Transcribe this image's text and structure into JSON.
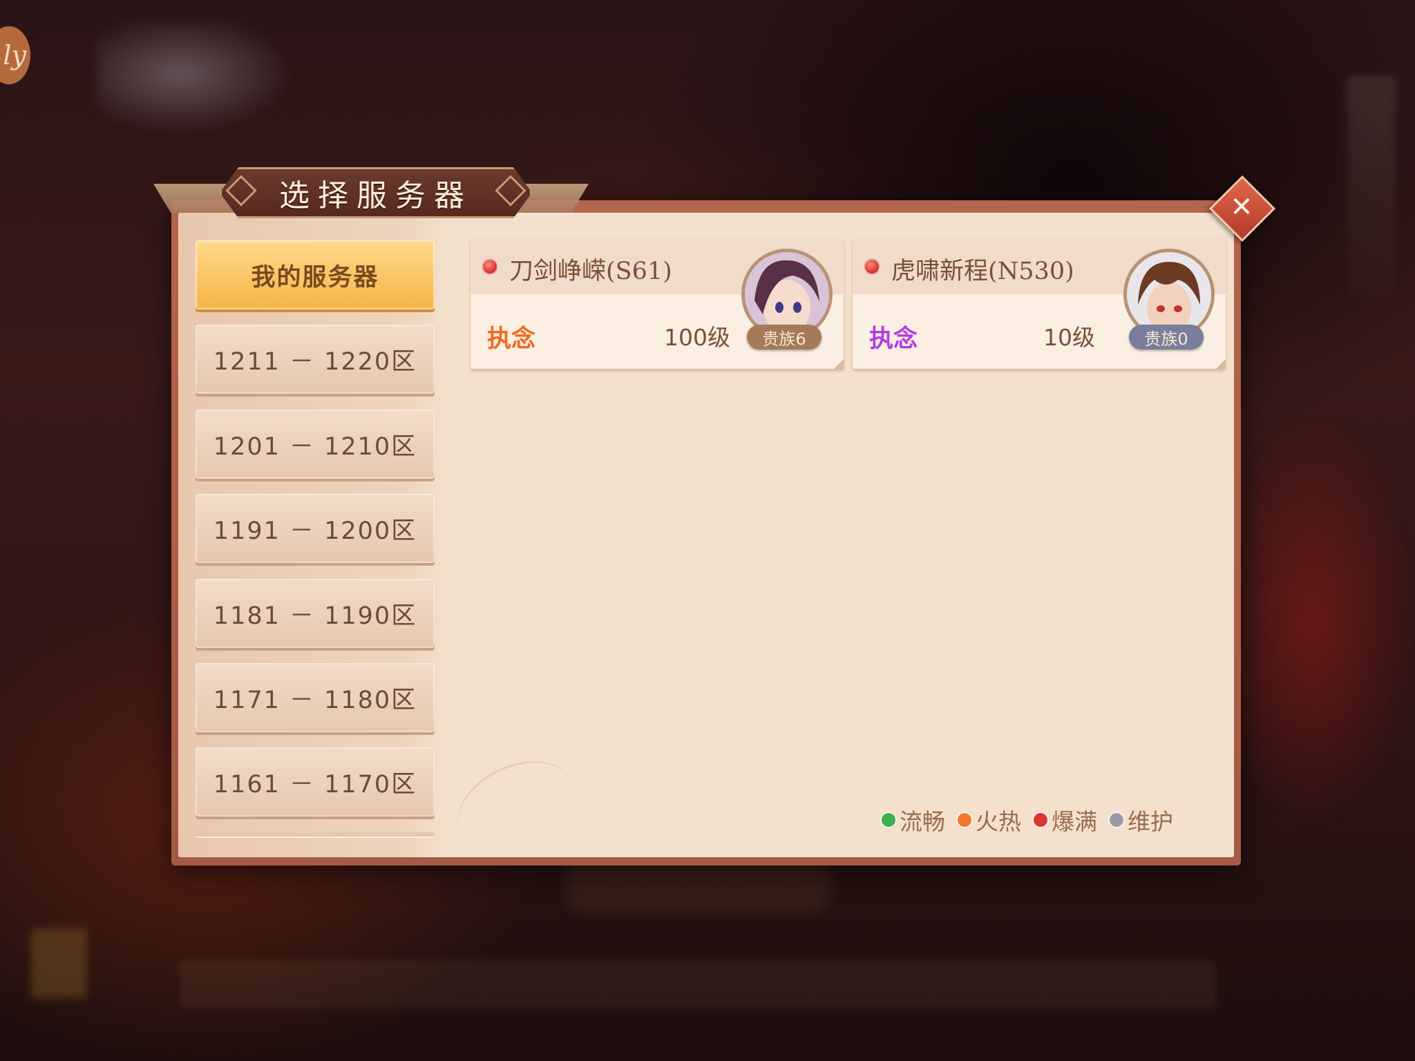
{
  "title": "选择服务器",
  "close_icon": "close-icon",
  "corner_logo_text": "ly",
  "sidebar": {
    "items": [
      {
        "label": "我的服务器",
        "active": true
      },
      {
        "label": "1211 － 1220区",
        "active": false
      },
      {
        "label": "1201 － 1210区",
        "active": false
      },
      {
        "label": "1191 － 1200区",
        "active": false
      },
      {
        "label": "1181 － 1190区",
        "active": false
      },
      {
        "label": "1171 － 1180区",
        "active": false
      },
      {
        "label": "1161 － 1170区",
        "active": false
      }
    ]
  },
  "servers": [
    {
      "name": "刀剑峥嵘(S61)",
      "status": "爆满",
      "character": "执念",
      "character_color": "#f06a1e",
      "level": "100级",
      "vip": "贵族6",
      "vip_color": "#a57a58"
    },
    {
      "name": "虎啸新程(N530)",
      "status": "爆满",
      "character": "执念",
      "character_color": "#b03de0",
      "level": "10级",
      "vip": "贵族0",
      "vip_color": "#7a7e9c"
    }
  ],
  "legend": [
    {
      "label": "流畅",
      "color": "#3bb24a"
    },
    {
      "label": "火热",
      "color": "#f07a2a"
    },
    {
      "label": "爆满",
      "color": "#e0342f"
    },
    {
      "label": "维护",
      "color": "#9a9aa0"
    }
  ]
}
